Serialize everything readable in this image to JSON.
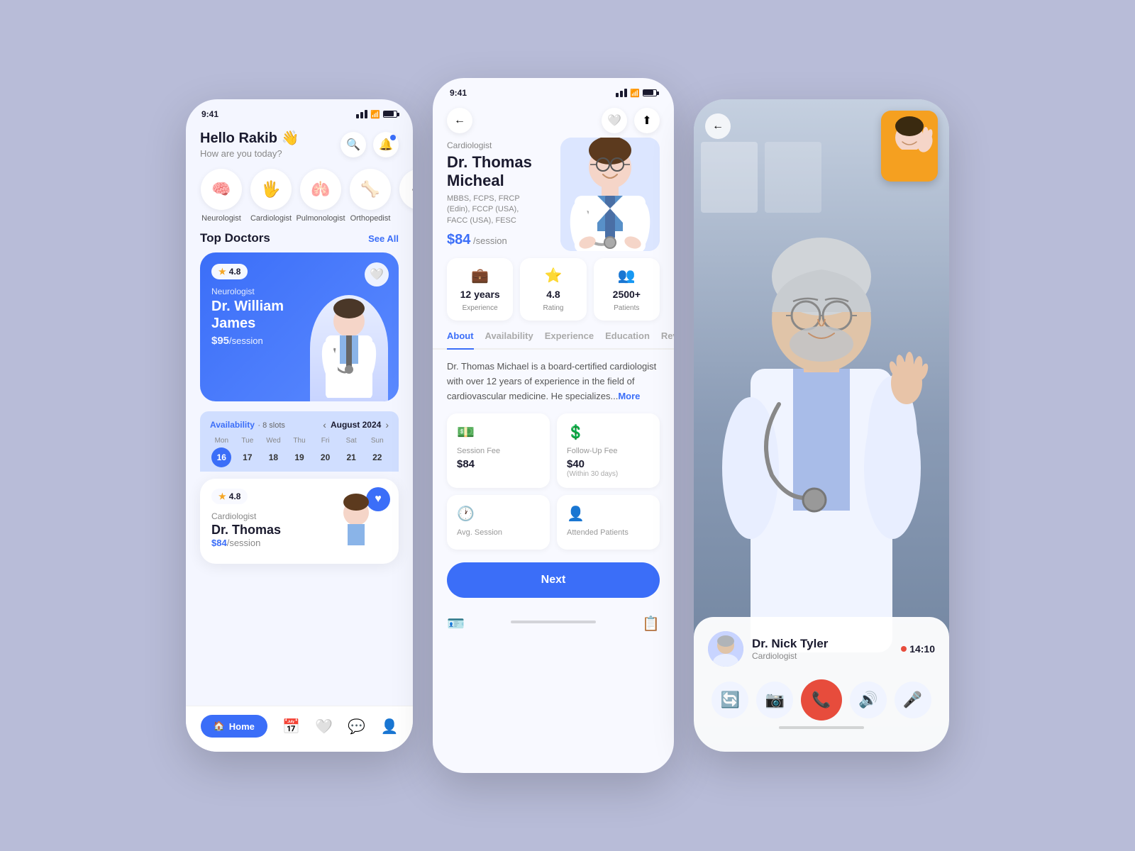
{
  "background": "#b8bcd8",
  "phone1": {
    "statusBar": {
      "time": "9:41"
    },
    "header": {
      "greeting": "Hello Rakib 👋",
      "subtitle": "How are you today?"
    },
    "categories": [
      {
        "icon": "🧠",
        "label": "Neurologist"
      },
      {
        "icon": "🖐",
        "label": "Cardiologist"
      },
      {
        "icon": "🫁",
        "label": "Pulmonologist"
      },
      {
        "icon": "🦴",
        "label": "Orthopedist"
      },
      {
        "icon": "K",
        "label": ""
      }
    ],
    "sectionTitle": "Top Doctors",
    "seeAllLabel": "See All",
    "doctorCard1": {
      "rating": "4.8",
      "specialty": "Neurologist",
      "name": "Dr. William\nJames",
      "price": "$95",
      "priceLabel": "/session"
    },
    "availability": {
      "label": "Availability",
      "slots": "8 slots",
      "month": "August 2024",
      "days": [
        {
          "name": "Mon",
          "num": "16",
          "active": true
        },
        {
          "name": "Tue",
          "num": "17",
          "active": false
        },
        {
          "name": "Wed",
          "num": "18",
          "active": false
        },
        {
          "name": "Thu",
          "num": "19",
          "active": false
        },
        {
          "name": "Fri",
          "num": "20",
          "active": false
        },
        {
          "name": "Sat",
          "num": "21",
          "active": false
        },
        {
          "name": "Sun",
          "num": "22",
          "active": false
        }
      ]
    },
    "doctorCard2": {
      "rating": "4.8",
      "specialty": "Cardiologist",
      "name": "Dr. Thomas",
      "price": "$84",
      "priceLabel": "/session"
    },
    "bottomNav": [
      {
        "icon": "🏠",
        "label": "Home",
        "active": true
      },
      {
        "icon": "📅",
        "label": "Schedule",
        "active": false
      },
      {
        "icon": "❤️",
        "label": "Favorites",
        "active": false
      },
      {
        "icon": "💬",
        "label": "Messages",
        "active": false
      },
      {
        "icon": "👤",
        "label": "Profile",
        "active": false
      }
    ]
  },
  "phone2": {
    "statusBar": {
      "time": "9:41"
    },
    "doctor": {
      "specialty": "Cardiologist",
      "name": "Dr. Thomas\nMicheal",
      "credentials": "MBBS, FCPS, FRCP\n(Edin), FCCP (USA),\nFACC (USA), FESC",
      "price": "$84",
      "priceLabel": "/session"
    },
    "stats": [
      {
        "icon": "💼",
        "value": "12 years",
        "label": "Experience"
      },
      {
        "icon": "⭐",
        "value": "4.8",
        "label": "Rating"
      },
      {
        "icon": "👥",
        "value": "2500+",
        "label": "Patients"
      }
    ],
    "tabs": [
      "About",
      "Availability",
      "Experience",
      "Education",
      "Review"
    ],
    "activeTab": "About",
    "aboutText": "Dr. Thomas Michael is a board-certified cardiologist with over 12 years of experience in the field of cardiovascular medicine. He specializes...",
    "moreLabel": "More",
    "fees": [
      {
        "icon": "💵",
        "label": "Session Fee",
        "value": "$84",
        "sub": ""
      },
      {
        "icon": "💲",
        "label": "Follow-Up Fee",
        "value": "$40",
        "sub": "(Within 30 days)"
      },
      {
        "icon": "🕐",
        "label": "Avg. Session",
        "value": "",
        "sub": ""
      },
      {
        "icon": "👤",
        "label": "Attended Patients",
        "value": "",
        "sub": ""
      }
    ],
    "nextButton": "Next"
  },
  "phone3": {
    "callerInfo": {
      "name": "Dr. Nick Tyler",
      "specialty": "Cardiologist",
      "timer": "14:10"
    },
    "controls": [
      {
        "icon": "🔄",
        "label": "flip"
      },
      {
        "icon": "📷",
        "label": "camera"
      },
      {
        "icon": "📞",
        "label": "end",
        "isEnd": true
      },
      {
        "icon": "🔊",
        "label": "speaker"
      },
      {
        "icon": "🎤",
        "label": "mute"
      }
    ]
  }
}
